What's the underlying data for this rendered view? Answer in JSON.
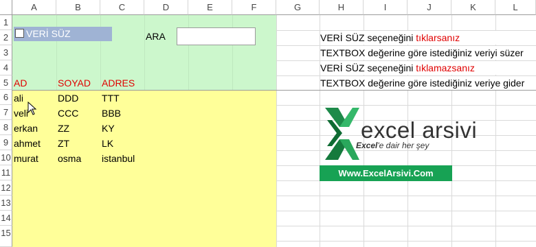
{
  "columns": [
    "A",
    "B",
    "C",
    "D",
    "E",
    "F",
    "G",
    "H",
    "I",
    "J",
    "K",
    "L"
  ],
  "rows": [
    "1",
    "2",
    "3",
    "4",
    "5",
    "6",
    "7",
    "8",
    "9",
    "10",
    "11",
    "12",
    "13",
    "14",
    "15"
  ],
  "controls": {
    "checkbox_label": "VERİ SÜZ",
    "search_label": "ARA",
    "search_value": ""
  },
  "table": {
    "headers": [
      "AD",
      "SOYAD",
      "ADRES"
    ],
    "rows": [
      [
        "ali",
        "DDD",
        "TTT"
      ],
      [
        "veli",
        "CCC",
        "BBB"
      ],
      [
        "erkan",
        "ZZ",
        "KY"
      ],
      [
        "ahmet",
        "ZT",
        "LK"
      ],
      [
        "murat",
        "osma",
        "istanbul"
      ]
    ]
  },
  "notes": [
    {
      "prefix": "VERİ SÜZ seçeneğini ",
      "highlight": "tıklarsanız"
    },
    {
      "prefix": "TEXTBOX değerine göre istediğiniz veriyi süzer",
      "highlight": ""
    },
    {
      "prefix": "VERİ SÜZ seçeneğini ",
      "highlight": "tıklamazsanız"
    },
    {
      "prefix": "TEXTBOX değerine göre istediğiniz veriye gider",
      "highlight": ""
    }
  ],
  "logo": {
    "name": "excel arsivi",
    "tagline_bold": "Excel",
    "tagline_rest": "'e dair her şey"
  },
  "banner": "Www.ExcelArsivi.Com",
  "colors": {
    "header_zone": "#ccf7cc",
    "data_zone": "#ffff99",
    "header_text": "#e00000",
    "banner": "#17a254",
    "checkbox_bg": "#9fb3d4"
  }
}
